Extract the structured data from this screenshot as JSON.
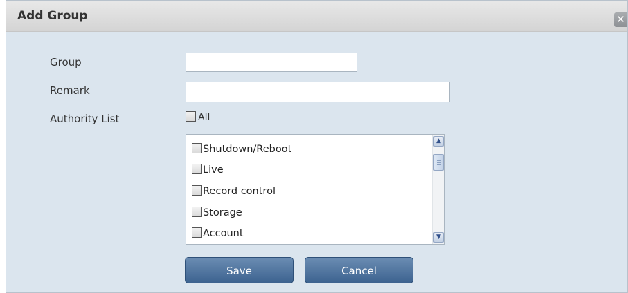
{
  "dialog": {
    "title": "Add Group",
    "close_glyph": "✕"
  },
  "form": {
    "group_label": "Group",
    "group_value": "",
    "remark_label": "Remark",
    "remark_value": "",
    "authority_label": "Authority List",
    "all_label": "All",
    "all_checked": false
  },
  "authority_items": [
    {
      "label": "Shutdown/Reboot",
      "checked": false
    },
    {
      "label": "Live",
      "checked": false
    },
    {
      "label": "Record control",
      "checked": false
    },
    {
      "label": "Storage",
      "checked": false
    },
    {
      "label": "Account",
      "checked": false
    }
  ],
  "buttons": {
    "save_label": "Save",
    "cancel_label": "Cancel"
  }
}
